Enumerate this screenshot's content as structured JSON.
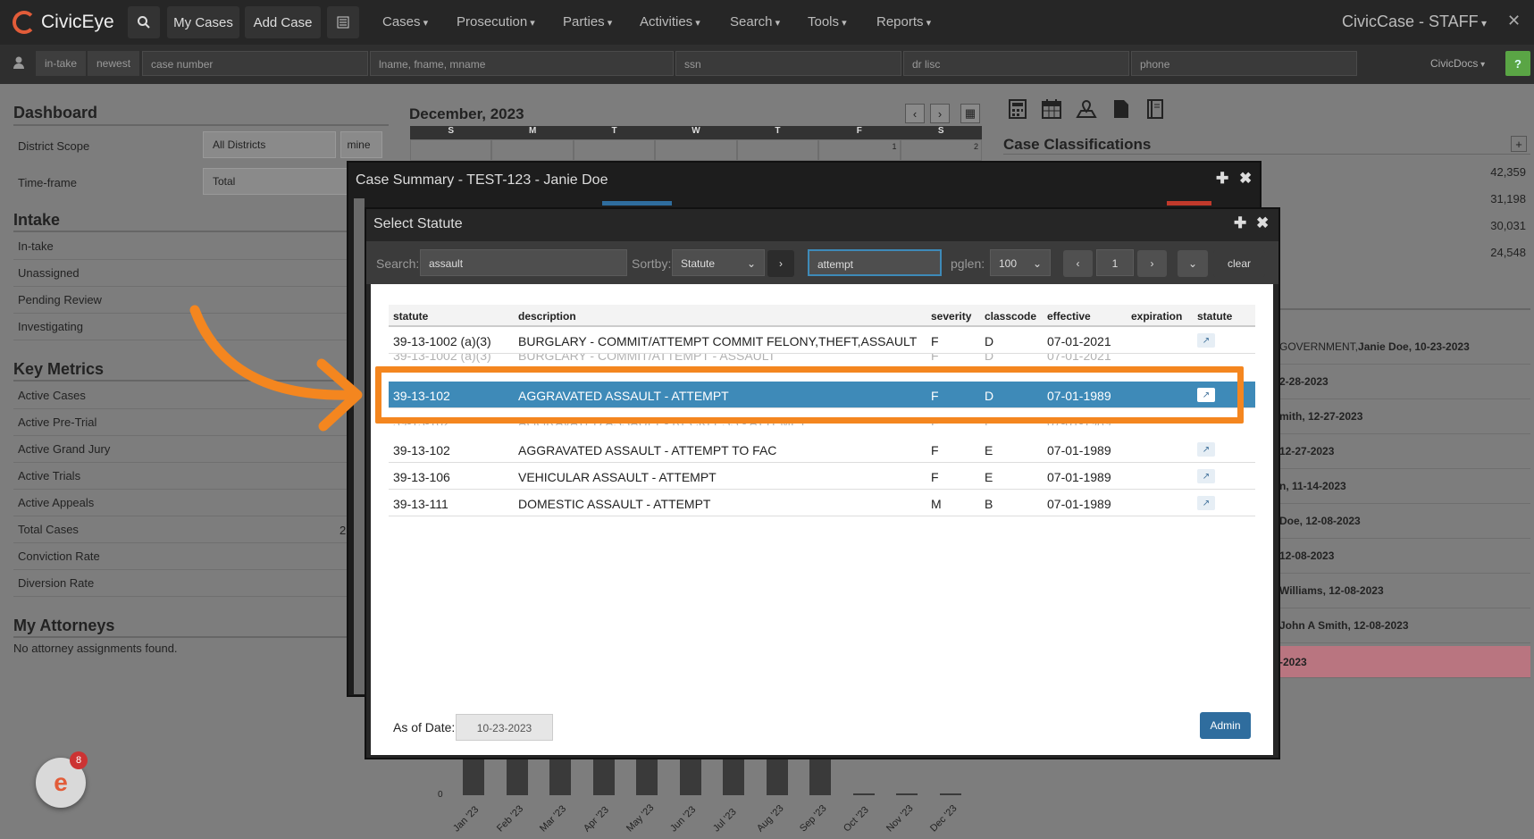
{
  "topnav": {
    "logo": "CivicEye",
    "buttons": {
      "my_cases": "My Cases",
      "add_case": "Add Case"
    },
    "menus": [
      "Cases",
      "Prosecution",
      "Parties",
      "Activities",
      "Search",
      "Tools",
      "Reports"
    ],
    "brand_right": "CivicCase - STAFF",
    "close": "✕"
  },
  "searchbar": {
    "tags": [
      "in-take",
      "newest"
    ],
    "placeholders": [
      "case number",
      "lname, fname, mname",
      "ssn",
      "dr lisc",
      "phone"
    ],
    "civicdocs": "CivicDocs",
    "help": "?"
  },
  "dashboard": {
    "title": "Dashboard",
    "district_label": "District Scope",
    "district_value": "All Districts",
    "mine": "mine",
    "timeframe_label": "Time-frame",
    "timeframe_value": "Total",
    "intake_title": "Intake",
    "intake_items": [
      "In-take",
      "Unassigned",
      "Pending Review",
      "Investigating"
    ],
    "metrics_title": "Key Metrics",
    "metrics_items": [
      "Active Cases",
      "Active Pre-Trial",
      "Active Grand Jury",
      "Active Trials",
      "Active Appeals",
      "Total Cases",
      "Conviction Rate",
      "Diversion Rate"
    ],
    "total_cases_partial": "2",
    "attorneys_title": "My Attorneys",
    "attorneys_empty": "No attorney assignments found."
  },
  "calendar": {
    "title": "December, 2023",
    "days": [
      "S",
      "M",
      "T",
      "W",
      "T",
      "F",
      "S"
    ],
    "first_row": [
      "",
      "",
      "",
      "",
      "",
      "1",
      "2"
    ]
  },
  "classifications": {
    "title": "Case Classifications",
    "values": [
      "42,359",
      "31,198",
      "30,031",
      "24,548"
    ],
    "items": [
      {
        "pre": "GOVERNMENT, ",
        "bold": "Janie Doe, 10-23-2023"
      },
      {
        "pre": "",
        "bold": "2-28-2023"
      },
      {
        "pre": "",
        "bold": "mith, 12-27-2023"
      },
      {
        "pre": "",
        "bold": "12-27-2023"
      },
      {
        "pre": "",
        "bold": "n, 11-14-2023"
      },
      {
        "pre": "",
        "bold": "Doe, 12-08-2023"
      },
      {
        "pre": "",
        "bold": "12-08-2023"
      },
      {
        "pre": "",
        "bold": "Williams, 12-08-2023"
      },
      {
        "pre": "",
        "bold": "John A Smith, 12-08-2023"
      },
      {
        "pre": "",
        "bold": "-2023"
      }
    ]
  },
  "chart_data": {
    "type": "bar",
    "categories": [
      "Jan '23",
      "Feb '23",
      "Mar '23",
      "Apr '23",
      "May '23",
      "Jun '23",
      "Jul '23",
      "Aug '23",
      "Sep '23",
      "Oct '23",
      "Nov '23",
      "Dec '23"
    ],
    "values": [
      null,
      null,
      null,
      null,
      null,
      null,
      null,
      null,
      null,
      0,
      0,
      0
    ],
    "yticks": [
      "0"
    ]
  },
  "badge": {
    "count": "8"
  },
  "case_modal": {
    "title": "Case Summary - TEST-123 - Janie Doe"
  },
  "statute_modal": {
    "title": "Select Statute",
    "search_label": "Search:",
    "search_value": "assault",
    "sortby_label": "Sortby:",
    "sortby_value": "Statute",
    "filter_value": "attempt",
    "pglen_label": "pglen:",
    "pglen_value": "100",
    "page_value": "1",
    "clear": "clear",
    "columns": [
      "statute",
      "description",
      "severity",
      "classcode",
      "effective",
      "expiration",
      "statute"
    ],
    "rows": [
      {
        "statute": "39-13-1002 (a)(3)",
        "description": "BURGLARY - COMMIT/ATTEMPT COMMIT FELONY,THEFT,ASSAULT",
        "severity": "F",
        "classcode": "D",
        "effective": "07-01-2021",
        "expiration": ""
      },
      {
        "statute": "39-13-1002 (a)(3)",
        "description": "BURGLARY - COMMIT/ATTEMPT - ASSAULT",
        "severity": "F",
        "classcode": "D",
        "effective": "07-01-2021",
        "expiration": ""
      },
      {
        "statute": "39-13-102",
        "description": "AGGRAVATED ASSAULT - ATTEMPT",
        "severity": "F",
        "classcode": "D",
        "effective": "07-01-1989",
        "expiration": ""
      },
      {
        "statute": "39-13-102",
        "description": "AGGRAVATED ASSAULT - RECKLESS - ATTEMPT",
        "severity": "F",
        "classcode": "E",
        "effective": "07-01-1989",
        "expiration": ""
      },
      {
        "statute": "39-13-102",
        "description": "AGGRAVATED ASSAULT - ATTEMPT TO FAC",
        "severity": "F",
        "classcode": "E",
        "effective": "07-01-1989",
        "expiration": ""
      },
      {
        "statute": "39-13-106",
        "description": "VEHICULAR ASSAULT - ATTEMPT",
        "severity": "F",
        "classcode": "E",
        "effective": "07-01-1989",
        "expiration": ""
      },
      {
        "statute": "39-13-111",
        "description": "DOMESTIC ASSAULT - ATTEMPT",
        "severity": "M",
        "classcode": "B",
        "effective": "07-01-1989",
        "expiration": ""
      }
    ],
    "asof_label": "As of Date:",
    "asof_value": "10-23-2023",
    "admin": "Admin"
  },
  "colors": {
    "accent": "#e25c39",
    "highlight": "#f4861f",
    "selected_row": "#3e8ab8",
    "admin_button": "#2f6d9e"
  }
}
